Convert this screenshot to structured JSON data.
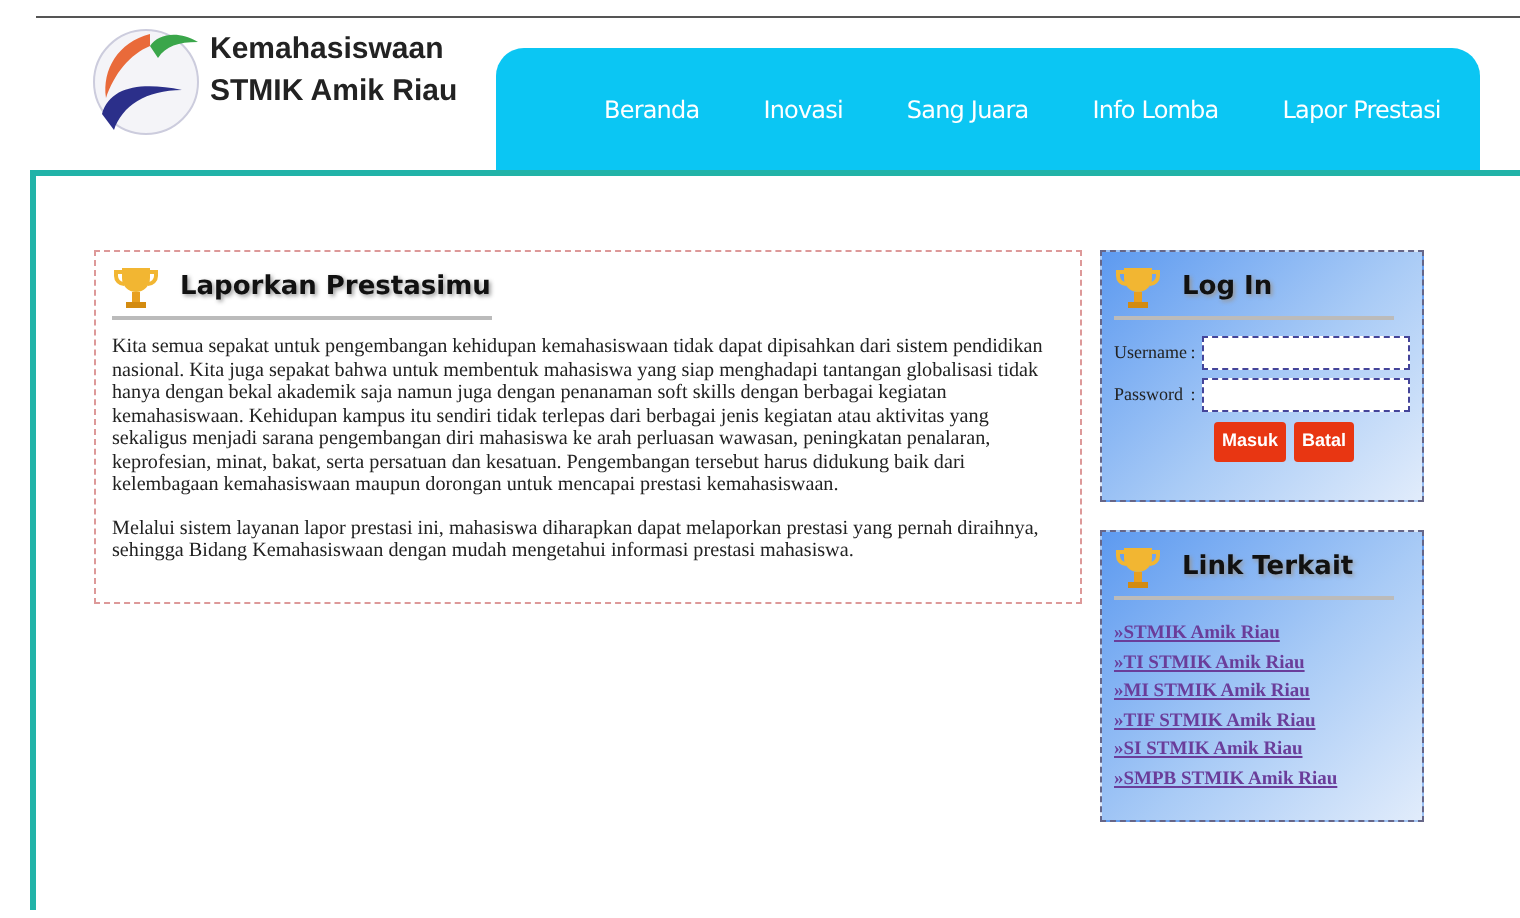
{
  "brand": {
    "line1": "Kemahasiswaan",
    "line2": "STMIK Amik Riau"
  },
  "nav": [
    {
      "label": "Beranda",
      "selected": false
    },
    {
      "label": "Inovasi",
      "selected": false
    },
    {
      "label": "Sang Juara",
      "selected": false
    },
    {
      "label": "Info Lomba",
      "selected": false
    },
    {
      "label": "Lapor Prestasi",
      "selected": false
    }
  ],
  "main": {
    "title": "Laporkan Prestasimu",
    "paragraphs": [
      "Kita semua sepakat untuk pengembangan kehidupan kemahasiswaan tidak dapat dipisahkan dari sistem pendidikan nasional. Kita juga sepakat bahwa untuk membentuk mahasiswa yang siap menghadapi tantangan globalisasi tidak hanya dengan bekal akademik saja namun juga dengan penanaman soft skills dengan berbagai kegiatan kemahasiswaan. Kehidupan kampus itu sendiri tidak terlepas dari berbagai jenis kegiatan atau aktivitas yang sekaligus menjadi sarana pengembangan diri mahasiswa ke arah perluasan wawasan, peningkatan penalaran, keprofesian, minat, bakat, serta persatuan dan kesatuan. Pengembangan tersebut harus didukung baik dari kelembagaan kemahasiswaan maupun dorongan untuk mencapai prestasi kemahasiswaan.",
      "Melalui sistem layanan lapor prestasi ini, mahasiswa diharapkan dapat melaporkan prestasi yang pernah diraihnya, sehingga Bidang Kemahasiswaan dengan mudah mengetahui informasi prestasi mahasiswa."
    ]
  },
  "login": {
    "title": "Log In",
    "fields": [
      {
        "label": "Username",
        "separator": ":"
      },
      {
        "label": "Password",
        "separator": ":"
      }
    ],
    "buttons": [
      "Masuk",
      "Batal"
    ]
  },
  "links": {
    "title": "Link Terkait",
    "items": [
      {
        "bullet": "»",
        "label": "STMIK Amik Riau"
      },
      {
        "bullet": "»",
        "label": "TI STMIK Amik Riau"
      },
      {
        "bullet": "»",
        "label": "MI STMIK Amik Riau"
      },
      {
        "bullet": "»",
        "label": "TIF STMIK Amik Riau"
      },
      {
        "bullet": "»",
        "label": "SI STMIK Amik Riau"
      },
      {
        "bullet": "»",
        "label": "SMPB STMIK Amik Riau"
      }
    ]
  }
}
